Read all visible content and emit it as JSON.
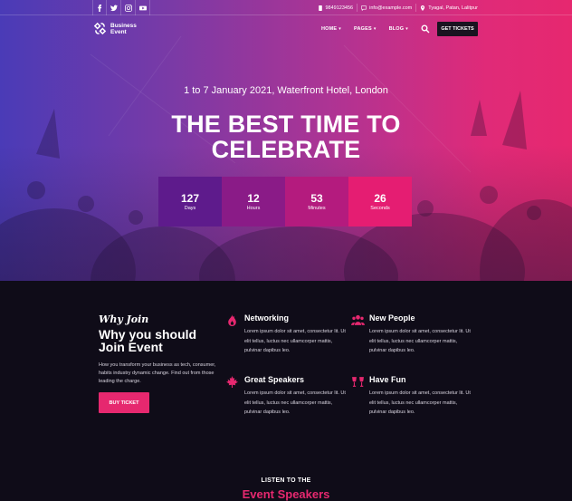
{
  "topbar": {
    "social": [
      {
        "icon": "facebook-icon"
      },
      {
        "icon": "twitter-icon"
      },
      {
        "icon": "instagram-icon"
      },
      {
        "icon": "youtube-icon"
      }
    ],
    "phone": "9849123456",
    "email": "info@example.com",
    "address": "Tyagal, Patan, Lalitpur"
  },
  "brand": {
    "line1": "Business",
    "line2": "Event"
  },
  "nav": {
    "items": [
      {
        "label": "HOME"
      },
      {
        "label": "PAGES"
      },
      {
        "label": "BLOG"
      }
    ],
    "cta": "GET TICKETS"
  },
  "hero": {
    "date": "1 to 7 January 2021, Waterfront Hotel, London",
    "title_line1": "THE BEST TIME TO",
    "title_line2": "CELEBRATE"
  },
  "countdown": [
    {
      "value": "127",
      "label": "Days",
      "color": "#5e1b8c"
    },
    {
      "value": "12",
      "label": "Hours",
      "color": "#8a1b87"
    },
    {
      "value": "53",
      "label": "Minutes",
      "color": "#b41b7e"
    },
    {
      "value": "26",
      "label": "Seconds",
      "color": "#e51d72"
    }
  ],
  "why": {
    "script": "Why Join",
    "title_line1": "Why you should",
    "title_line2": "Join Event",
    "description": "How you transform your business as tech, consumer, habits industry dynamic change. Find out from those leading the charge.",
    "button": "BUY TICKET"
  },
  "features": [
    {
      "title": "Networking",
      "icon": "flame-icon",
      "text": "Lorem ipsum dolor sit amet, consectetur lit. Ut elit tellus, luctus nec ullamcorper mattis, pulvinar dapibus leo."
    },
    {
      "title": "New People",
      "icon": "people-icon",
      "text": "Lorem ipsum dolor sit amet, consectetur lit. Ut elit tellus, luctus nec ullamcorper mattis, pulvinar dapibus leo."
    },
    {
      "title": "Great Speakers",
      "icon": "maple-leaf-icon",
      "text": "Lorem ipsum dolor sit amet, consectetur lit. Ut elit tellus, luctus nec ullamcorper mattis, pulvinar dapibus leo."
    },
    {
      "title": "Have Fun",
      "icon": "glasses-cheers-icon",
      "text": "Lorem ipsum dolor sit amet, consectetur lit. Ut elit tellus, luctus nec ullamcorper mattis, pulvinar dapibus leo."
    }
  ],
  "speakers_section": {
    "eyebrow": "LISTEN TO THE",
    "title": "Event Speakers"
  },
  "colors": {
    "accent": "#e6286f",
    "dark": "#0f0c18"
  }
}
